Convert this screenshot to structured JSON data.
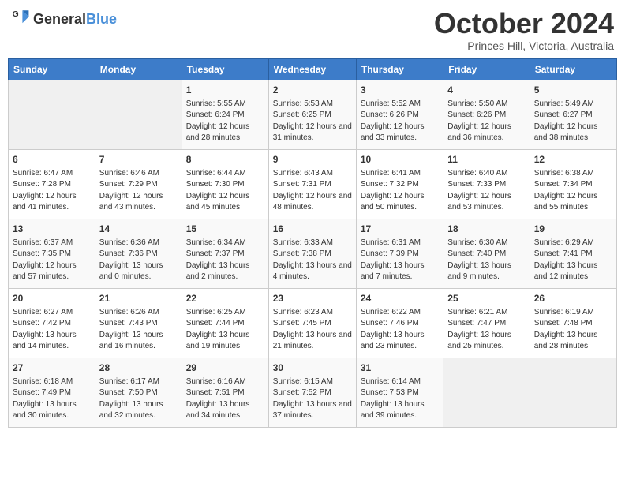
{
  "header": {
    "logo_general": "General",
    "logo_blue": "Blue",
    "month": "October 2024",
    "location": "Princes Hill, Victoria, Australia"
  },
  "days_of_week": [
    "Sunday",
    "Monday",
    "Tuesday",
    "Wednesday",
    "Thursday",
    "Friday",
    "Saturday"
  ],
  "weeks": [
    [
      {
        "day": "",
        "sunrise": "",
        "sunset": "",
        "daylight": ""
      },
      {
        "day": "",
        "sunrise": "",
        "sunset": "",
        "daylight": ""
      },
      {
        "day": "1",
        "sunrise": "Sunrise: 5:55 AM",
        "sunset": "Sunset: 6:24 PM",
        "daylight": "Daylight: 12 hours and 28 minutes."
      },
      {
        "day": "2",
        "sunrise": "Sunrise: 5:53 AM",
        "sunset": "Sunset: 6:25 PM",
        "daylight": "Daylight: 12 hours and 31 minutes."
      },
      {
        "day": "3",
        "sunrise": "Sunrise: 5:52 AM",
        "sunset": "Sunset: 6:26 PM",
        "daylight": "Daylight: 12 hours and 33 minutes."
      },
      {
        "day": "4",
        "sunrise": "Sunrise: 5:50 AM",
        "sunset": "Sunset: 6:26 PM",
        "daylight": "Daylight: 12 hours and 36 minutes."
      },
      {
        "day": "5",
        "sunrise": "Sunrise: 5:49 AM",
        "sunset": "Sunset: 6:27 PM",
        "daylight": "Daylight: 12 hours and 38 minutes."
      }
    ],
    [
      {
        "day": "6",
        "sunrise": "Sunrise: 6:47 AM",
        "sunset": "Sunset: 7:28 PM",
        "daylight": "Daylight: 12 hours and 41 minutes."
      },
      {
        "day": "7",
        "sunrise": "Sunrise: 6:46 AM",
        "sunset": "Sunset: 7:29 PM",
        "daylight": "Daylight: 12 hours and 43 minutes."
      },
      {
        "day": "8",
        "sunrise": "Sunrise: 6:44 AM",
        "sunset": "Sunset: 7:30 PM",
        "daylight": "Daylight: 12 hours and 45 minutes."
      },
      {
        "day": "9",
        "sunrise": "Sunrise: 6:43 AM",
        "sunset": "Sunset: 7:31 PM",
        "daylight": "Daylight: 12 hours and 48 minutes."
      },
      {
        "day": "10",
        "sunrise": "Sunrise: 6:41 AM",
        "sunset": "Sunset: 7:32 PM",
        "daylight": "Daylight: 12 hours and 50 minutes."
      },
      {
        "day": "11",
        "sunrise": "Sunrise: 6:40 AM",
        "sunset": "Sunset: 7:33 PM",
        "daylight": "Daylight: 12 hours and 53 minutes."
      },
      {
        "day": "12",
        "sunrise": "Sunrise: 6:38 AM",
        "sunset": "Sunset: 7:34 PM",
        "daylight": "Daylight: 12 hours and 55 minutes."
      }
    ],
    [
      {
        "day": "13",
        "sunrise": "Sunrise: 6:37 AM",
        "sunset": "Sunset: 7:35 PM",
        "daylight": "Daylight: 12 hours and 57 minutes."
      },
      {
        "day": "14",
        "sunrise": "Sunrise: 6:36 AM",
        "sunset": "Sunset: 7:36 PM",
        "daylight": "Daylight: 13 hours and 0 minutes."
      },
      {
        "day": "15",
        "sunrise": "Sunrise: 6:34 AM",
        "sunset": "Sunset: 7:37 PM",
        "daylight": "Daylight: 13 hours and 2 minutes."
      },
      {
        "day": "16",
        "sunrise": "Sunrise: 6:33 AM",
        "sunset": "Sunset: 7:38 PM",
        "daylight": "Daylight: 13 hours and 4 minutes."
      },
      {
        "day": "17",
        "sunrise": "Sunrise: 6:31 AM",
        "sunset": "Sunset: 7:39 PM",
        "daylight": "Daylight: 13 hours and 7 minutes."
      },
      {
        "day": "18",
        "sunrise": "Sunrise: 6:30 AM",
        "sunset": "Sunset: 7:40 PM",
        "daylight": "Daylight: 13 hours and 9 minutes."
      },
      {
        "day": "19",
        "sunrise": "Sunrise: 6:29 AM",
        "sunset": "Sunset: 7:41 PM",
        "daylight": "Daylight: 13 hours and 12 minutes."
      }
    ],
    [
      {
        "day": "20",
        "sunrise": "Sunrise: 6:27 AM",
        "sunset": "Sunset: 7:42 PM",
        "daylight": "Daylight: 13 hours and 14 minutes."
      },
      {
        "day": "21",
        "sunrise": "Sunrise: 6:26 AM",
        "sunset": "Sunset: 7:43 PM",
        "daylight": "Daylight: 13 hours and 16 minutes."
      },
      {
        "day": "22",
        "sunrise": "Sunrise: 6:25 AM",
        "sunset": "Sunset: 7:44 PM",
        "daylight": "Daylight: 13 hours and 19 minutes."
      },
      {
        "day": "23",
        "sunrise": "Sunrise: 6:23 AM",
        "sunset": "Sunset: 7:45 PM",
        "daylight": "Daylight: 13 hours and 21 minutes."
      },
      {
        "day": "24",
        "sunrise": "Sunrise: 6:22 AM",
        "sunset": "Sunset: 7:46 PM",
        "daylight": "Daylight: 13 hours and 23 minutes."
      },
      {
        "day": "25",
        "sunrise": "Sunrise: 6:21 AM",
        "sunset": "Sunset: 7:47 PM",
        "daylight": "Daylight: 13 hours and 25 minutes."
      },
      {
        "day": "26",
        "sunrise": "Sunrise: 6:19 AM",
        "sunset": "Sunset: 7:48 PM",
        "daylight": "Daylight: 13 hours and 28 minutes."
      }
    ],
    [
      {
        "day": "27",
        "sunrise": "Sunrise: 6:18 AM",
        "sunset": "Sunset: 7:49 PM",
        "daylight": "Daylight: 13 hours and 30 minutes."
      },
      {
        "day": "28",
        "sunrise": "Sunrise: 6:17 AM",
        "sunset": "Sunset: 7:50 PM",
        "daylight": "Daylight: 13 hours and 32 minutes."
      },
      {
        "day": "29",
        "sunrise": "Sunrise: 6:16 AM",
        "sunset": "Sunset: 7:51 PM",
        "daylight": "Daylight: 13 hours and 34 minutes."
      },
      {
        "day": "30",
        "sunrise": "Sunrise: 6:15 AM",
        "sunset": "Sunset: 7:52 PM",
        "daylight": "Daylight: 13 hours and 37 minutes."
      },
      {
        "day": "31",
        "sunrise": "Sunrise: 6:14 AM",
        "sunset": "Sunset: 7:53 PM",
        "daylight": "Daylight: 13 hours and 39 minutes."
      },
      {
        "day": "",
        "sunrise": "",
        "sunset": "",
        "daylight": ""
      },
      {
        "day": "",
        "sunrise": "",
        "sunset": "",
        "daylight": ""
      }
    ]
  ]
}
